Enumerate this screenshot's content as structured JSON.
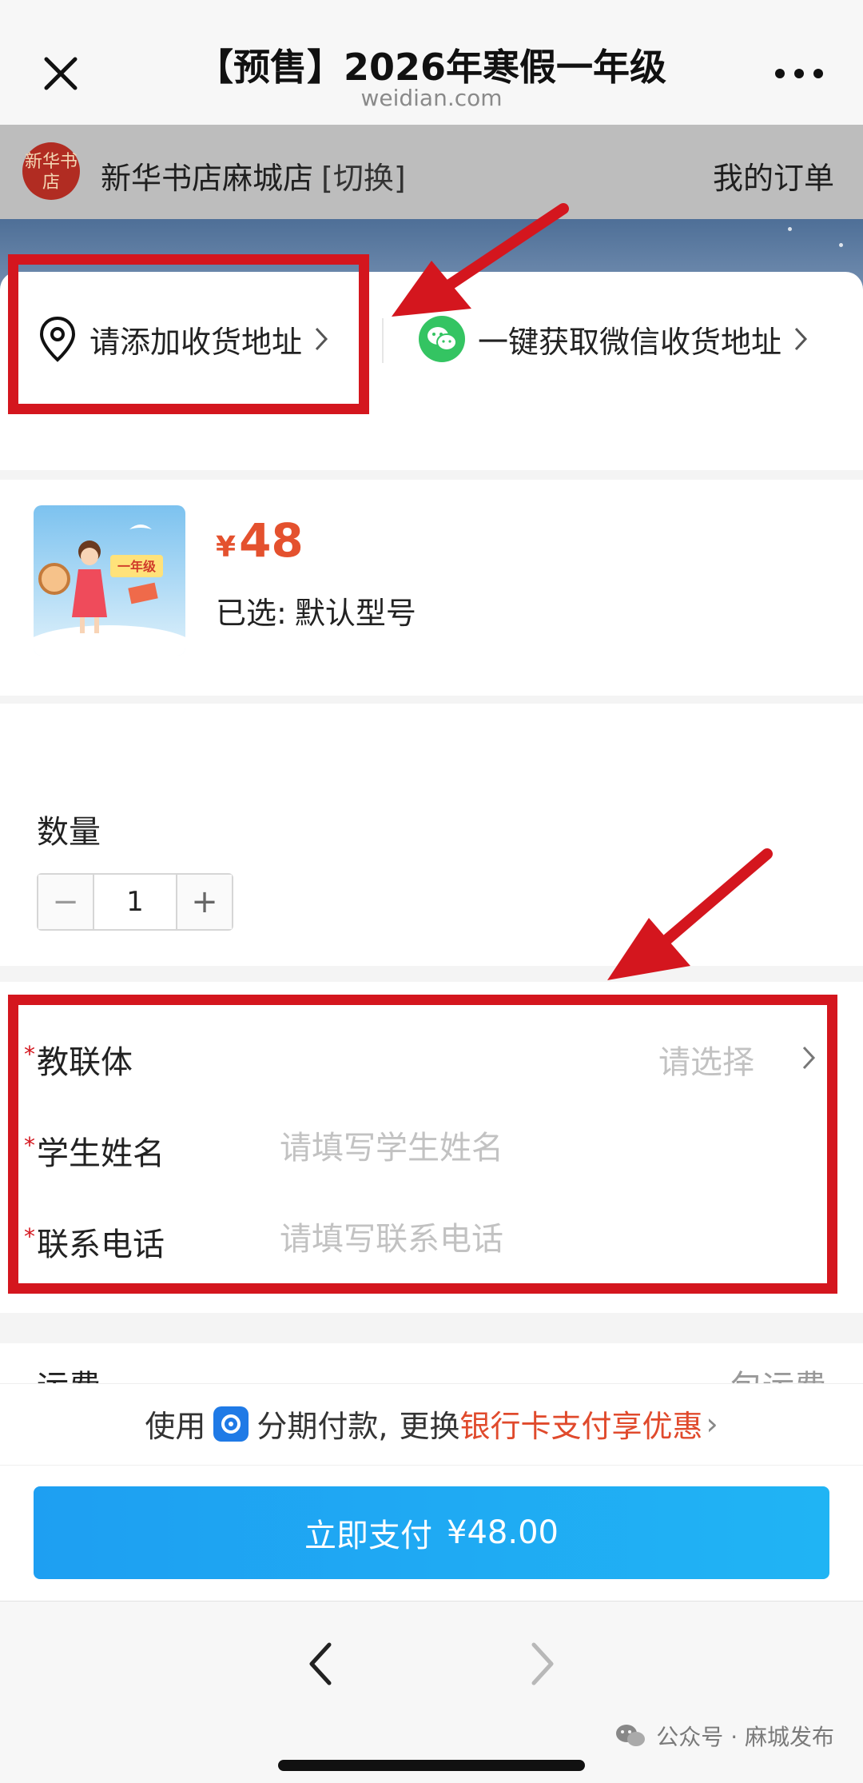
{
  "nav": {
    "title": "【预售】2026年寒假一年级",
    "domain": "weidian.com"
  },
  "store": {
    "logo_text": "新华书店",
    "name": "新华书店麻城店",
    "switch_label": "[切换]",
    "orders_label": "我的订单"
  },
  "address": {
    "add_label": "请添加收货地址",
    "wechat_label": "一键获取微信收货地址"
  },
  "product": {
    "currency": "¥",
    "price": "48",
    "selected_label": "已选:",
    "selected_value": "默认型号",
    "thumb_text": "一年级"
  },
  "quantity": {
    "label": "数量",
    "value": "1",
    "minus": "−",
    "plus": "+"
  },
  "form": {
    "rows": [
      {
        "label": "教联体",
        "placeholder": "请选择"
      },
      {
        "label": "学生姓名",
        "placeholder": "请填写学生姓名"
      },
      {
        "label": "联系电话",
        "placeholder": "请填写联系电话"
      }
    ],
    "required_mark": "*"
  },
  "shipping": {
    "label": "运费",
    "value": "包运费"
  },
  "promo": {
    "prefix": "使用",
    "installment": "分期付款,",
    "change": "更换",
    "highlight": "银行卡支付享优惠",
    "chevron": "›"
  },
  "pay": {
    "label": "立即支付",
    "amount": "¥48.00"
  },
  "footer": {
    "watermark": "公众号 · 麻城发布"
  },
  "colors": {
    "highlight_red": "#d4161e",
    "price_orange": "#e4512e",
    "pay_blue": "#1e9ff2",
    "wechat_green": "#34c462"
  }
}
